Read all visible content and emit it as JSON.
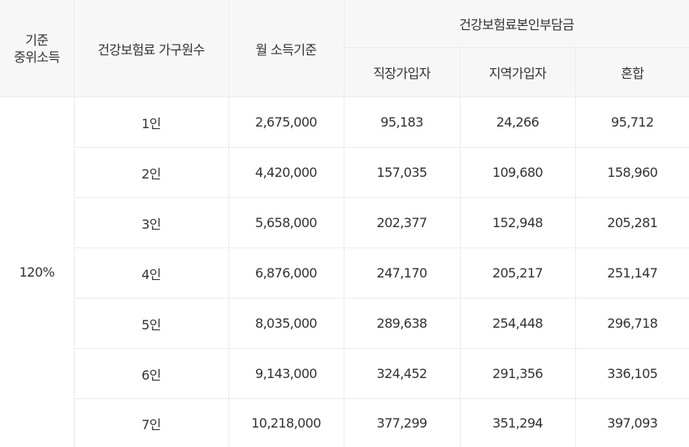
{
  "table": {
    "headers": {
      "standard_line1": "기준",
      "standard_line2": "중위소득",
      "household": "건강보험료 가구원수",
      "monthly_income": "월 소득기준",
      "premium_group": "건강보험료본인부담금",
      "employee": "직장가입자",
      "regional": "지역가입자",
      "mixed": "혼합"
    },
    "standard_rate": "120%",
    "rows": [
      {
        "household": "1인",
        "income": "2,675,000",
        "employee": "95,183",
        "regional": "24,266",
        "mixed": "95,712"
      },
      {
        "household": "2인",
        "income": "4,420,000",
        "employee": "157,035",
        "regional": "109,680",
        "mixed": "158,960"
      },
      {
        "household": "3인",
        "income": "5,658,000",
        "employee": "202,377",
        "regional": "152,948",
        "mixed": "205,281"
      },
      {
        "household": "4인",
        "income": "6,876,000",
        "employee": "247,170",
        "regional": "205,217",
        "mixed": "251,147"
      },
      {
        "household": "5인",
        "income": "8,035,000",
        "employee": "289,638",
        "regional": "254,448",
        "mixed": "296,718"
      },
      {
        "household": "6인",
        "income": "9,143,000",
        "employee": "324,452",
        "regional": "291,356",
        "mixed": "336,105"
      },
      {
        "household": "7인",
        "income": "10,218,000",
        "employee": "377,299",
        "regional": "351,294",
        "mixed": "397,093"
      }
    ]
  }
}
